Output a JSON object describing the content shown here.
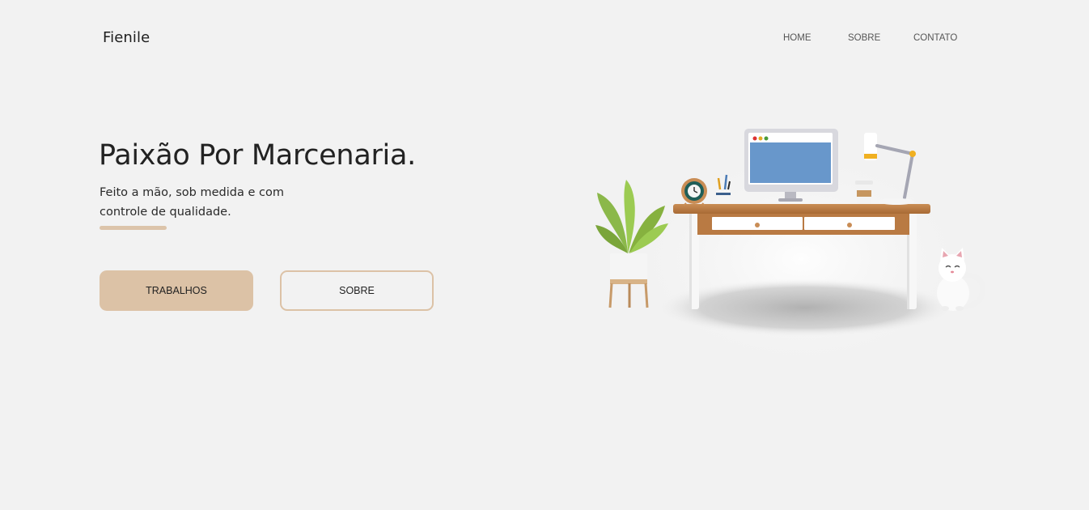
{
  "brand": {
    "name": "Fienile"
  },
  "nav": {
    "items": [
      {
        "label": "HOME"
      },
      {
        "label": "SOBRE"
      },
      {
        "label": "CONTATO"
      }
    ]
  },
  "hero": {
    "title": "Paixão Por Marcenaria.",
    "subtitle": "Feito a mão, sob medida e com controle de qualidade.",
    "primary_button": "TRABALHOS",
    "secondary_button": "SOBRE"
  },
  "colors": {
    "background": "#f2f2f2",
    "accent": "#dcc2a6",
    "text": "#222222"
  },
  "illustration": {
    "icons": [
      "desk-icon",
      "monitor-icon",
      "plant-icon",
      "clock-icon",
      "lamp-icon",
      "coffee-cup-icon",
      "pencil-cup-icon",
      "cat-icon"
    ]
  }
}
